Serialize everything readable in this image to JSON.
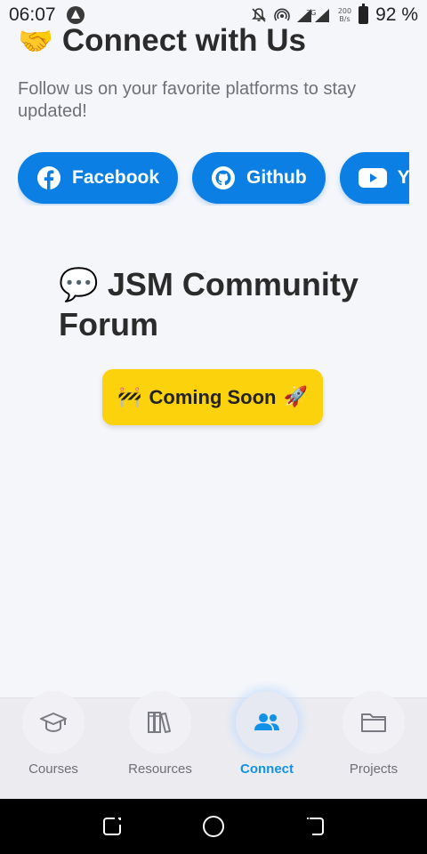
{
  "status_bar": {
    "time": "06:07",
    "net_rate_value": "200",
    "net_rate_unit": "B/s",
    "battery_percent": "92 %"
  },
  "header": {
    "title_emoji": "🤝",
    "title": "Connect with Us",
    "subtitle": "Follow us on your favorite platforms to stay updated!"
  },
  "social": [
    {
      "label": "Facebook",
      "icon": "facebook-icon"
    },
    {
      "label": "Github",
      "icon": "github-icon"
    },
    {
      "label": "YouTube",
      "icon": "youtube-icon"
    }
  ],
  "forum": {
    "emoji": "💬",
    "title": "JSM Community Forum",
    "coming_soon_left": "🚧",
    "coming_soon": "Coming Soon",
    "coming_soon_right": "🚀"
  },
  "tabs": [
    {
      "label": "Courses",
      "icon": "graduation-cap-icon",
      "active": false
    },
    {
      "label": "Resources",
      "icon": "books-icon",
      "active": false
    },
    {
      "label": "Connect",
      "icon": "users-icon",
      "active": true
    },
    {
      "label": "Projects",
      "icon": "folder-icon",
      "active": false
    }
  ],
  "colors": {
    "accent": "#0b7fe3",
    "active_tab": "#1192e8",
    "coming_soon_bg": "#fcd20c",
    "background": "#f5f6fa"
  }
}
